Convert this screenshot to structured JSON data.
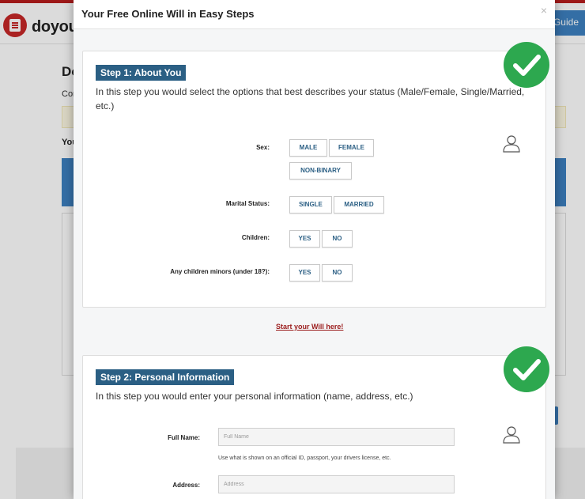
{
  "background": {
    "logo_text": "doyour",
    "guide_label": "Guide",
    "heading": "Do",
    "line1": "Con",
    "line2": "You"
  },
  "modal": {
    "title": "Your Free Online Will in Easy Steps",
    "close_label": "×",
    "start_link": "Start your Will here!"
  },
  "step1": {
    "label": "Step 1: About You",
    "description": "In this step you would select the options that best describes your status (Male/Female, Single/Married, etc.)",
    "fields": {
      "sex": {
        "label": "Sex:",
        "options": [
          "MALE",
          "FEMALE",
          "NON-BINARY"
        ]
      },
      "marital": {
        "label": "Marital Status:",
        "options": [
          "SINGLE",
          "MARRIED"
        ]
      },
      "children": {
        "label": "Children:",
        "options": [
          "YES",
          "NO"
        ]
      },
      "minors": {
        "label": "Any children minors (under 18?):",
        "options": [
          "YES",
          "NO"
        ]
      }
    }
  },
  "step2": {
    "label": "Step 2: Personal Information",
    "description": "In this step you would enter your personal information (name, address, etc.)",
    "full_name": {
      "label": "Full Name:",
      "placeholder": "Full Name",
      "hint": "Use what is shown on an official ID, passport, your drivers license, etc."
    },
    "address": {
      "label": "Address:",
      "placeholder": "Address"
    }
  },
  "colors": {
    "step_label_bg": "#2b5f84",
    "check_green": "#2da84f",
    "link_red": "#9b1c1c",
    "brand_red": "#c62828",
    "guide_blue": "#3d80c1"
  },
  "icons": [
    "document-icon",
    "close-icon",
    "checkmark-icon",
    "person-icon"
  ]
}
